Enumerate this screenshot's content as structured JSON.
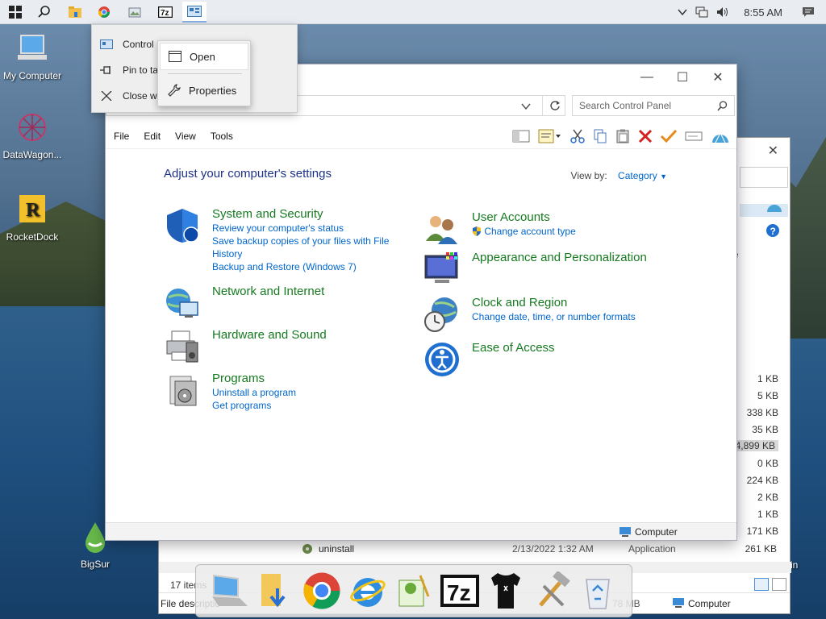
{
  "taskbar": {
    "clock": "8:55 AM"
  },
  "desktop_icons": [
    {
      "label": "My Computer"
    },
    {
      "label": "DataWagon..."
    },
    {
      "label": "RocketDock"
    },
    {
      "label": "BigSur"
    },
    {
      "label": "e Bin"
    }
  ],
  "jumplist": {
    "items": [
      "Control P",
      "Pin to ta",
      "Close w"
    ]
  },
  "context_menu": {
    "open": "Open",
    "properties": "Properties"
  },
  "control_panel": {
    "search_placeholder": "Search Control Panel",
    "menu": [
      "File",
      "Edit",
      "View",
      "Tools"
    ],
    "heading": "Adjust your computer's settings",
    "view_by_label": "View by:",
    "view_by_value": "Category",
    "status_computer": "Computer",
    "categories": [
      {
        "title": "System and Security",
        "links": [
          "Review your computer's status",
          "Save backup copies of your files with File History",
          "Backup and Restore (Windows 7)"
        ]
      },
      {
        "title": "Network and Internet",
        "links": []
      },
      {
        "title": "Hardware and Sound",
        "links": []
      },
      {
        "title": "Programs",
        "links": [
          "Uninstall a program",
          "Get programs"
        ]
      },
      {
        "title": "User Accounts",
        "links": [
          "Change account type"
        ]
      },
      {
        "title": "Appearance and Personalization",
        "links": []
      },
      {
        "title": "Clock and Region",
        "links": [
          "Change date, time, or number formats"
        ]
      },
      {
        "title": "Ease of Access",
        "links": []
      }
    ]
  },
  "explorer_bg": {
    "sizes": [
      "1 KB",
      "5 KB",
      "338 KB",
      "35 KB",
      "4,899 KB",
      "0 KB",
      "224 KB",
      "2 KB",
      "1 KB",
      "171 KB",
      "261 KB"
    ],
    "last_row": {
      "name": "uninstall",
      "date": "2/13/2022 1:32 AM",
      "type": "Application"
    },
    "status_items": "17 items",
    "status_computer": "Computer",
    "status_size": "78 MB",
    "file_desc": "File descriptio",
    "col_e": "e"
  },
  "colors": {
    "link": "#0066cc",
    "category_title": "#167a20",
    "heading": "#1e3287"
  }
}
